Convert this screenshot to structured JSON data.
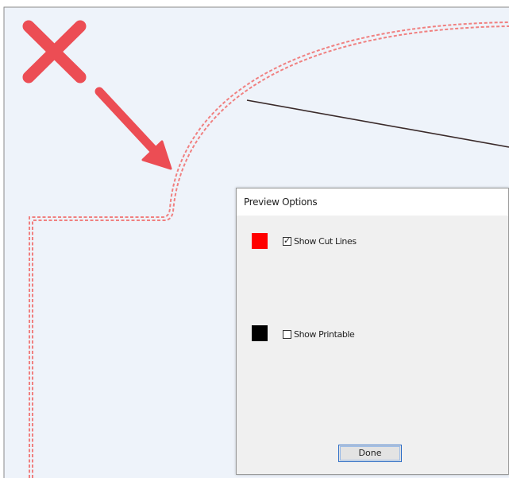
{
  "colors": {
    "background": "#eef3fa",
    "border": "#8a8a8a",
    "cut_line": "#f08080",
    "x_mark": "#ec4d54",
    "arrow": "#ec4d54",
    "leader_line": "#3a2a2a"
  },
  "annotation": {
    "x_mark_icon": "close-icon",
    "arrow_icon": "arrow-down-right-icon"
  },
  "dialog": {
    "title": "Preview Options",
    "options": [
      {
        "label": "Show Cut Lines",
        "checked": true,
        "swatch_color": "#ff0000"
      },
      {
        "label": "Show Printable",
        "checked": false,
        "swatch_color": "#000000"
      }
    ],
    "done_label": "Done"
  }
}
